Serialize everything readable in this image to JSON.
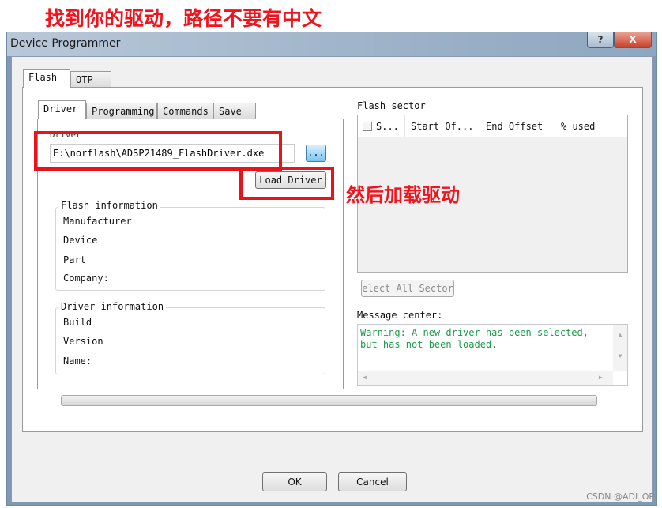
{
  "annotations": {
    "top": "找到你的驱动，路径不要有中文",
    "side": "然后加载驱动",
    "watermark": "CSDN @ADI_OP"
  },
  "window": {
    "title": "Device Programmer",
    "help_label": "?",
    "close_label": "X"
  },
  "outer_tabs": [
    {
      "label": "Flash",
      "active": true
    },
    {
      "label": "OTP",
      "active": false
    }
  ],
  "inner_tabs": [
    {
      "label": "Driver",
      "active": true
    },
    {
      "label": "Programming"
    },
    {
      "label": "Commands"
    },
    {
      "label": "Save"
    }
  ],
  "driver": {
    "label": "Driver",
    "path": "E:\\norflash\\ADSP21489_FlashDriver.dxe",
    "browse_label": "...",
    "load_label": "Load Driver"
  },
  "flash_info": {
    "title": "Flash information",
    "fields": [
      "Manufacturer",
      "Device",
      "Part",
      "Company:"
    ]
  },
  "driver_info": {
    "title": "Driver information",
    "fields": [
      "Build",
      "Version",
      "Name:"
    ]
  },
  "flash_sector": {
    "title": "Flash sector",
    "columns": [
      "S...",
      "Start Of...",
      "End Offset",
      "% used"
    ],
    "select_all_label": "elect All Sector"
  },
  "message_center": {
    "title": "Message center:",
    "lines": [
      "Warning: A new driver has been selected,",
      "but has not been loaded."
    ],
    "color": "#1e9a4a"
  },
  "footer": {
    "ok_label": "OK",
    "cancel_label": "Cancel"
  }
}
